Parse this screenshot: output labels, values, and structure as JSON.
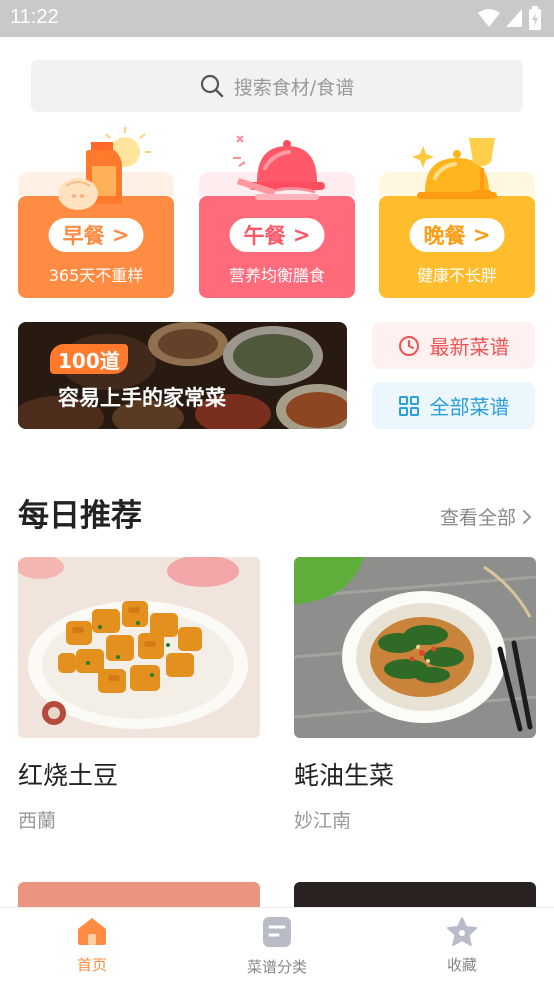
{
  "status_bar": {
    "time": "11:22"
  },
  "search": {
    "placeholder": "搜索食材/食谱"
  },
  "meals": [
    {
      "label": "早餐",
      "subtitle": "365天不重样",
      "color": "#ff8c42"
    },
    {
      "label": "午餐",
      "subtitle": "营养均衡膳食",
      "color": "#ff6b7a"
    },
    {
      "label": "晚餐",
      "subtitle": "健康不长胖",
      "color": "#ffbd2e"
    }
  ],
  "banner": {
    "badge": "100道",
    "text": "容易上手的家常菜"
  },
  "shortcuts": {
    "latest": "最新菜谱",
    "all": "全部菜谱"
  },
  "daily": {
    "title": "每日推荐",
    "more": "查看全部",
    "recipes": [
      {
        "name": "红烧土豆",
        "author": "西蘭"
      },
      {
        "name": "蚝油生菜",
        "author": "妙江南"
      }
    ]
  },
  "tabbar": {
    "items": [
      {
        "label": "首页",
        "active": true
      },
      {
        "label": "菜谱分类",
        "active": false
      },
      {
        "label": "收藏",
        "active": false
      }
    ],
    "active_color": "#ff8c42",
    "inactive_color": "#b8bcc8"
  }
}
